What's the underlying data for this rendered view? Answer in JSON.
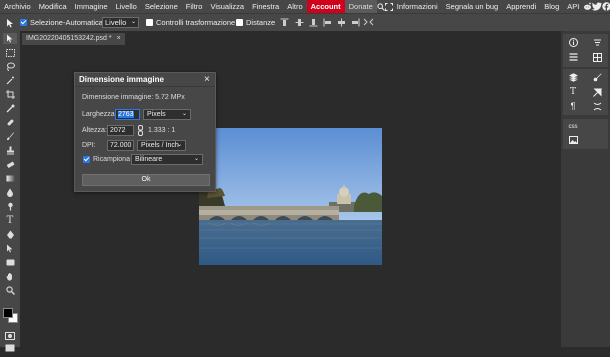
{
  "menu": {
    "items": [
      "Archivio",
      "Modifica",
      "Immagine",
      "Livello",
      "Selezione",
      "Filtro",
      "Visualizza",
      "Finestra",
      "Altro"
    ],
    "account": "Account",
    "donate": "Donate",
    "right_items": [
      "Informazioni",
      "Segnala un bug",
      "Apprendi",
      "Blog",
      "API"
    ]
  },
  "options": {
    "auto_select_label": "Selezione-Automatica",
    "layer_select_value": "Livello",
    "transform_controls_label": "Controlli trasformazione",
    "distances_label": "Distanze"
  },
  "document": {
    "tab_label": "IMG20220405153242.psd *",
    "close_glyph": "×"
  },
  "dialog": {
    "title": "Dimensione immagine",
    "close_glyph": "×",
    "size_text": "Dimensione immagine: 5.72 MPx",
    "width_label": "Larghezza:",
    "width_value": "2763",
    "width_unit": "Pixels",
    "height_label": "Altezza:",
    "height_value": "2072",
    "ratio_text": "1.333 : 1",
    "dpi_label": "DPI:",
    "dpi_value": "72.000",
    "dpi_unit": "Pixels / Inch",
    "resample_label": "Ricampiona",
    "resample_checked": true,
    "resample_method": "Bilineare",
    "ok_label": "Ok"
  },
  "right_panel": {
    "css_label": "css"
  },
  "colors": {
    "accent": "#2b78e4",
    "account_red": "#d0021b",
    "panel": "#474747",
    "background": "#2b2b2b"
  }
}
